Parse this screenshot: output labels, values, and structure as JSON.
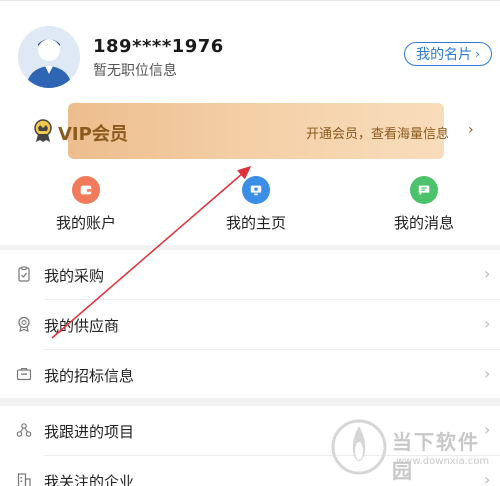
{
  "profile": {
    "phone": "189****1976",
    "subtitle": "暂无职位信息",
    "card_button": "我的名片"
  },
  "vip": {
    "label": "VIP会员",
    "description": "开通会员，查看海量信息"
  },
  "quick_actions": [
    {
      "label": "我的账户",
      "icon": "wallet-icon",
      "color": "#f07a5a"
    },
    {
      "label": "我的主页",
      "icon": "homepage-icon",
      "color": "#3a8ee6"
    },
    {
      "label": "我的消息",
      "icon": "message-icon",
      "color": "#4cc36a"
    }
  ],
  "menu_group_1": [
    {
      "label": "我的采购",
      "icon": "clipboard-icon"
    },
    {
      "label": "我的供应商",
      "icon": "supplier-badge-icon"
    },
    {
      "label": "我的招标信息",
      "icon": "tender-icon"
    }
  ],
  "menu_group_2": [
    {
      "label": "我跟进的项目",
      "icon": "project-icon"
    },
    {
      "label": "我关注的企业",
      "icon": "building-icon"
    }
  ],
  "watermark": {
    "title": "当下软件园",
    "url": "www.downxia.com"
  },
  "colors": {
    "accent_blue": "#2e7bd6",
    "vip_gold": "#8a5a1e",
    "annotation_arrow": "#e0303a"
  }
}
